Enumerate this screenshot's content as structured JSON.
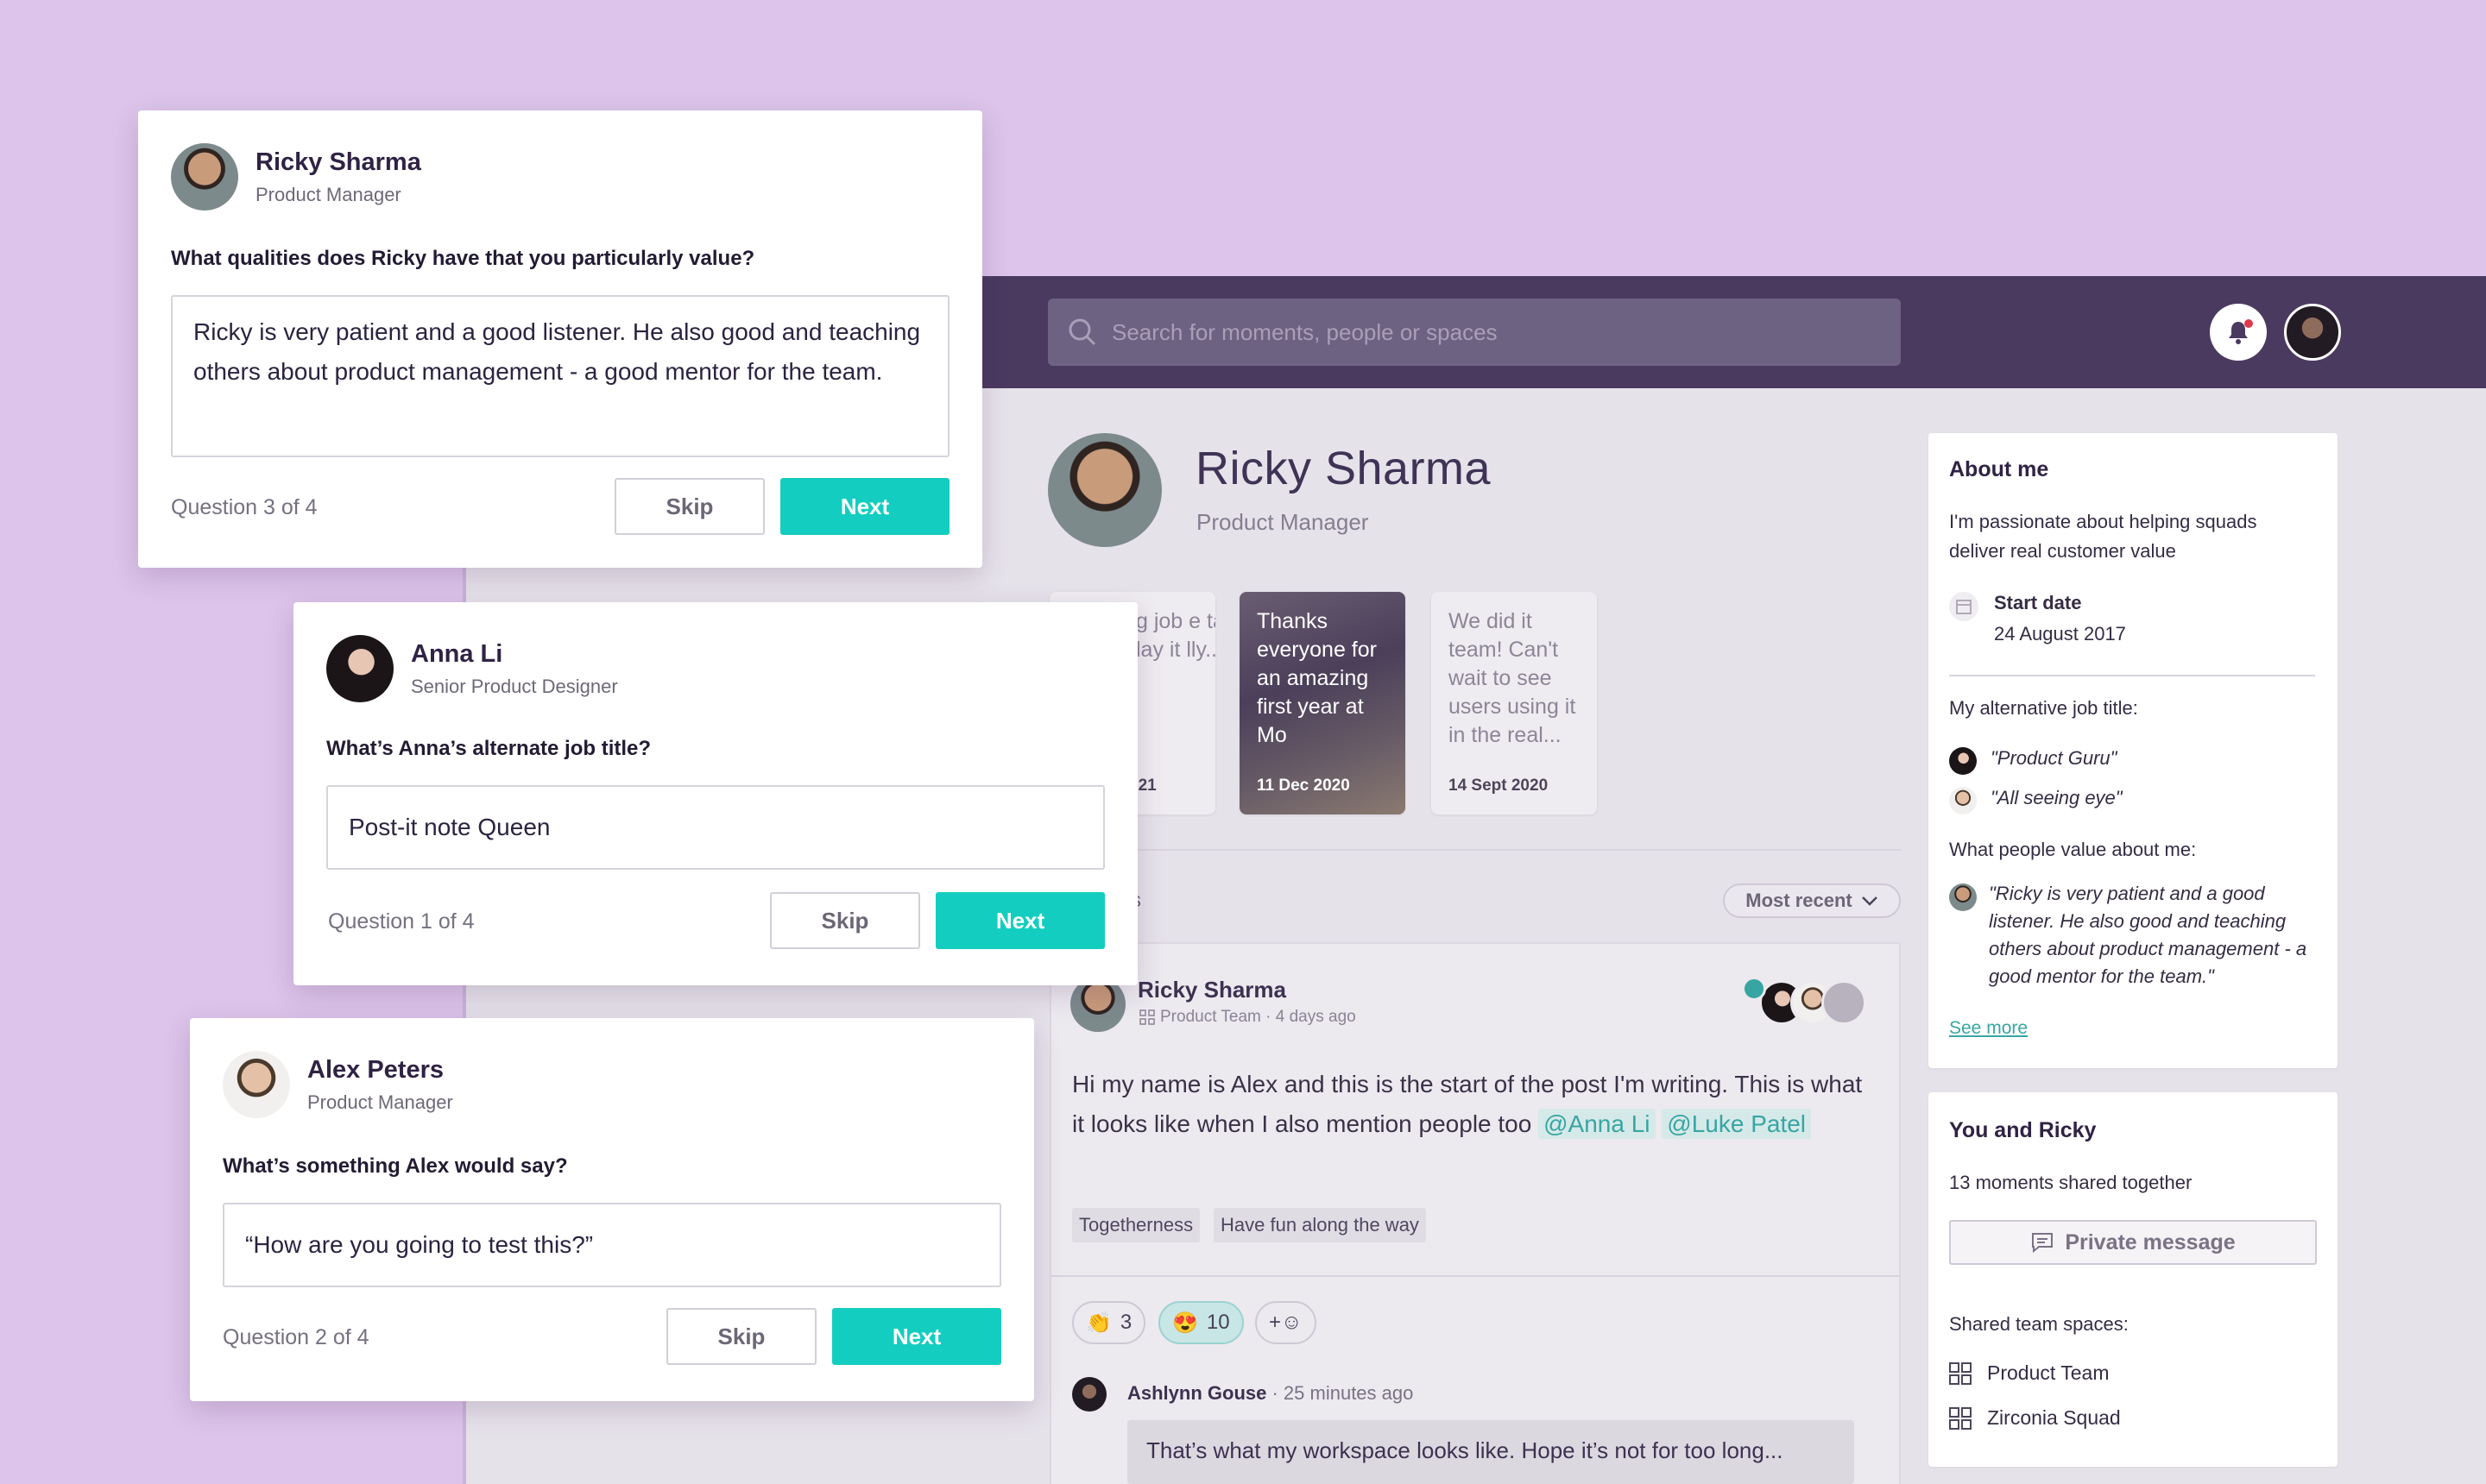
{
  "colors": {
    "background": "#dcc4ea",
    "topbar": "#4a3a60",
    "accent": "#13cec0",
    "mention": "#37a6a2",
    "notification_dot": "#e0384c"
  },
  "search": {
    "placeholder": "Search for moments, people or spaces"
  },
  "survey_cards": [
    {
      "name": "Ricky Sharma",
      "role": "Product Manager",
      "question": "What qualities does Ricky have that you particularly value?",
      "answer": "Ricky is very patient and a good listener. He also good and teaching others about product management - a good mentor for the team.",
      "progress": "Question 3 of 4",
      "skip": "Skip",
      "next": "Next"
    },
    {
      "name": "Anna Li",
      "role": "Senior Product Designer",
      "question": "What’s Anna’s alternate job title?",
      "answer": "Post-it note Queen",
      "progress": "Question 1 of 4",
      "skip": "Skip",
      "next": "Next"
    },
    {
      "name": "Alex Peters",
      "role": "Product Manager",
      "question": "What’s something Alex would say?",
      "answer": "“How are you going to test this?”",
      "progress": "Question 2 of 4",
      "skip": "Skip",
      "next": "Next"
    }
  ],
  "profile": {
    "name": "Ricky Sharma",
    "role": "Product Manager"
  },
  "moments": [
    {
      "text": "g job e tation lay it lly...",
      "date": "021"
    },
    {
      "text": "Thanks everyone for an amazing first year at Mo",
      "date": "11 Dec 2020"
    },
    {
      "text": "We did it team! Can't wait to see users using it in the real...",
      "date": "14 Sept 2020"
    }
  ],
  "feed": {
    "section_fragment": "s",
    "sort_label": "Most recent",
    "post": {
      "author": "Ricky Sharma",
      "meta": "Product Team · 4 days ago",
      "body_text": "Hi my name is Alex and this is the start of the post I'm writing. This is what it looks like when I also mention people too",
      "mentions": [
        "@Anna Li",
        "@Luke Patel"
      ],
      "tags": [
        "Togetherness",
        "Have fun along the way"
      ],
      "reactions": [
        {
          "emoji": "👏",
          "count": "3"
        },
        {
          "emoji": "😍",
          "count": "10"
        }
      ],
      "add_reaction": "+☺",
      "comment": {
        "author": "Ashlynn Gouse",
        "time": "· 25 minutes ago",
        "text": "That’s what my workspace looks like. Hope it’s not for too long..."
      }
    }
  },
  "about": {
    "title": "About me",
    "bio": "I'm passionate about helping squads deliver real customer value",
    "start_date_label": "Start date",
    "start_date": "24 August 2017",
    "alt_title_heading": "My alternative job title:",
    "alt_titles": [
      "\"Product Guru\"",
      "\"All seeing eye\""
    ],
    "value_heading": "What people value about me:",
    "value_quote": "\"Ricky is very patient and a good listener. He also good and teaching others about product management - a good mentor for the team.\"",
    "see_more": "See more"
  },
  "you_and": {
    "title": "You and Ricky",
    "shared": "13 moments shared together",
    "message_button": "Private message",
    "spaces_heading": "Shared team spaces:",
    "spaces": [
      "Product Team",
      "Zirconia Squad"
    ]
  }
}
